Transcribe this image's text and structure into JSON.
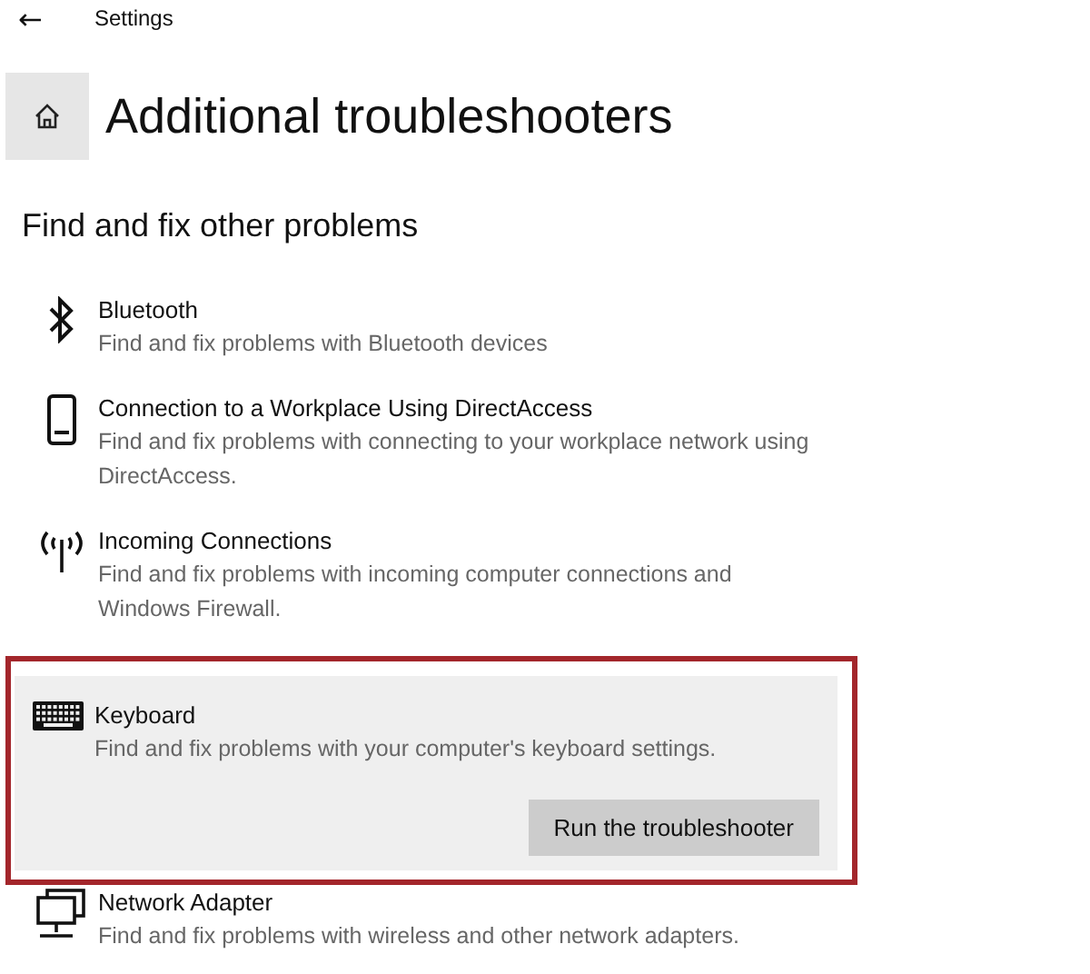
{
  "header": {
    "back": "←",
    "title": "Settings"
  },
  "page": {
    "title": "Additional troubleshooters"
  },
  "section": {
    "heading": "Find and fix other problems"
  },
  "items": [
    {
      "kind": "bluetooth",
      "title": "Bluetooth",
      "description": "Find and fix problems with Bluetooth devices",
      "expanded": false,
      "highlighted": false
    },
    {
      "kind": "phone",
      "title": "Connection to a Workplace Using DirectAccess",
      "description": "Find and fix problems with connecting to your workplace network using DirectAccess.",
      "expanded": false,
      "highlighted": false
    },
    {
      "kind": "antenna",
      "title": "Incoming Connections",
      "description": "Find and fix problems with incoming computer connections and Windows Firewall.",
      "expanded": false,
      "highlighted": false
    },
    {
      "kind": "keyboard",
      "title": "Keyboard",
      "description": "Find and fix problems with your computer's keyboard settings.",
      "expanded": true,
      "highlighted": true,
      "button": "Run the troubleshooter"
    },
    {
      "kind": "network",
      "title": "Network Adapter",
      "description": "Find and fix problems with wireless and other network adapters.",
      "expanded": false,
      "highlighted": false
    }
  ]
}
